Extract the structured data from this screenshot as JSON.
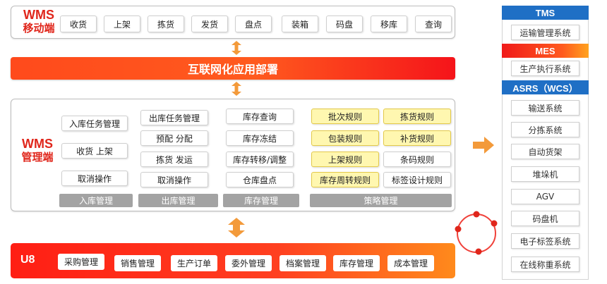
{
  "wms_mobile": {
    "title_line1": "WMS",
    "title_line2": "移动端",
    "items": [
      "收货",
      "上架",
      "拣货",
      "发货",
      "盘点",
      "装箱",
      "码盘",
      "移库",
      "查询"
    ]
  },
  "internet_deployment": "互联网化应用部署",
  "wms_management": {
    "title_line1": "WMS",
    "title_line2": "管理端",
    "groups": [
      {
        "label": "入库管理",
        "items": [
          "入库任务管理",
          "收货 上架",
          "取消操作"
        ]
      },
      {
        "label": "出库管理",
        "items": [
          "出库任务管理",
          "预配 分配",
          "拣货 发运",
          "取消操作"
        ]
      },
      {
        "label": "库存管理",
        "items": [
          "库存查询",
          "库存冻结",
          "库存转移/调整",
          "仓库盘点"
        ]
      },
      {
        "label": "策略管理",
        "items": [
          "批次规则",
          "拣货规则",
          "包装规则",
          "补货规则",
          "上架规则",
          "条码规则",
          "库存周转规则",
          "标签设计规则"
        ]
      }
    ]
  },
  "u8": {
    "title": "U8",
    "items": [
      "采购管理",
      "销售管理",
      "生产订单",
      "委外管理",
      "档案管理",
      "库存管理",
      "成本管理"
    ]
  },
  "right_panel": {
    "tms": {
      "header": "TMS",
      "items": [
        "运输管理系统"
      ]
    },
    "mes": {
      "header": "MES",
      "items": [
        "生产执行系统"
      ]
    },
    "asrs": {
      "header": "ASRS（WCS）",
      "items": [
        "输送系统",
        "分拣系统",
        "自动货架",
        "堆垛机",
        "AGV",
        "码盘机",
        "电子标签系统",
        "在线称重系统"
      ]
    }
  },
  "colors": {
    "brand_red": "#e0261b",
    "banner_orange": "#ff4a1c",
    "header_blue": "#1f6fc5",
    "strategy_yellow": "#fff7b0",
    "grey_label": "#a3a3a3",
    "arrow_orange": "#f39a3a"
  },
  "icons": {
    "double_arrow": "double-arrow-vertical-icon",
    "right_arrow": "arrow-right-icon",
    "cycle": "integration-cycle-icon"
  }
}
